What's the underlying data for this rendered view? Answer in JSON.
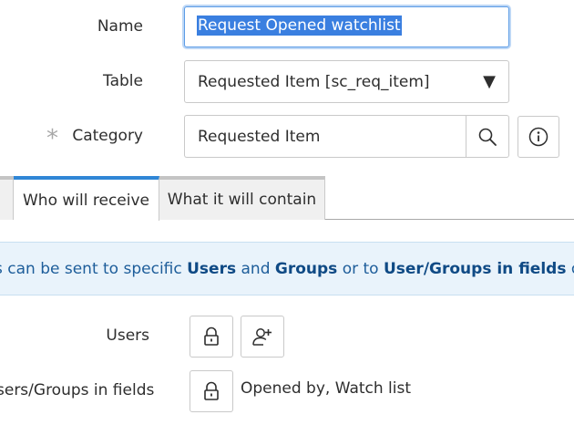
{
  "form": {
    "name": {
      "label": "Name",
      "value": "Request Opened watchlist"
    },
    "table": {
      "label": "Table",
      "value": "Requested Item [sc_req_item]"
    },
    "category": {
      "label": "Category",
      "required_mark": "*",
      "value": "Requested Item"
    }
  },
  "tabs": [
    {
      "label": ""
    },
    {
      "label": "Who will receive"
    },
    {
      "label": "What it will contain"
    }
  ],
  "info_banner": {
    "part1": "s can be sent to specific ",
    "users": "Users",
    "and": " and ",
    "groups": "Groups",
    "or_to": " or to ",
    "user_groups_in_fields": "User/Groups in fields",
    "rest": " on the rec"
  },
  "recipients": {
    "users_label": "Users",
    "fields_label": "sers/Groups in fields",
    "fields_value": "Opened by, Watch list"
  },
  "icons": {
    "dropdown": "caret-down-icon",
    "lookup": "search-icon",
    "info": "info-icon",
    "lock": "lock-icon",
    "add_me": "add-user-icon"
  },
  "colors": {
    "accent": "#2f86d6",
    "selection": "#3a7fe0",
    "banner_bg": "#e9f3fb",
    "banner_text": "#1d5d9a"
  }
}
